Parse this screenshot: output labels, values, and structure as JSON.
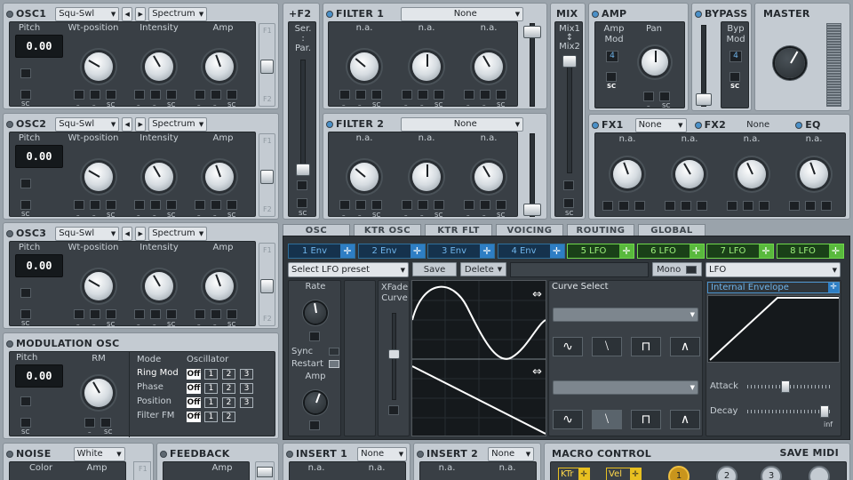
{
  "osc_rows": [
    {
      "title": "OSC1",
      "wave": "Squ-Swl",
      "mode": "Spectrum",
      "labels": [
        "Pitch",
        "Wt-position",
        "Intensity",
        "Amp"
      ],
      "pitch": "0.00"
    },
    {
      "title": "OSC2",
      "wave": "Squ-Swl",
      "mode": "Spectrum",
      "labels": [
        "Pitch",
        "Wt-position",
        "Intensity",
        "Amp"
      ],
      "pitch": "0.00"
    },
    {
      "title": "OSC3",
      "wave": "Squ-Swl",
      "mode": "Spectrum",
      "labels": [
        "Pitch",
        "Wt-position",
        "Intensity",
        "Amp"
      ],
      "pitch": "0.00"
    }
  ],
  "osc_f1": "F1",
  "osc_f2": "F2",
  "sc": "SC",
  "dash": "–",
  "arrow_left": "◀",
  "arrow_right": "▶",
  "f2_label": "+F2",
  "ser": "Ser.",
  "colon": ":",
  "par": "Par.",
  "filters": [
    {
      "title": "FILTER 1",
      "type": "None",
      "knobs": [
        "n.a.",
        "n.a.",
        "n.a."
      ]
    },
    {
      "title": "FILTER 2",
      "type": "None",
      "knobs": [
        "n.a.",
        "n.a.",
        "n.a."
      ]
    }
  ],
  "mix": {
    "title": "MIX",
    "top": "Mix1",
    "bot": "Mix2",
    "arrow": "↕"
  },
  "amp": {
    "title": "AMP",
    "mod": "Amp Mod",
    "mod_val": "4",
    "pan": "Pan"
  },
  "bypass": {
    "title": "BYPASS",
    "mod": "Byp Mod",
    "val": "4"
  },
  "master": {
    "title": "MASTER"
  },
  "fx": {
    "fx1": "FX1",
    "fx1_type": "None",
    "fx2": "FX2",
    "fx2_type": "None",
    "eq": "EQ",
    "knobs": [
      "n.a.",
      "n.a.",
      "n.a.",
      "n.a."
    ]
  },
  "tabs": [
    "OSC",
    "KTR OSC",
    "KTR FLT",
    "VOICING",
    "ROUTING",
    "GLOBAL"
  ],
  "mod_slots": [
    "1 Env",
    "2 Env",
    "3 Env",
    "4 Env",
    "5 LFO",
    "6 LFO",
    "7 LFO",
    "8 LFO"
  ],
  "move_icon": "✛",
  "lfo": {
    "preset": "Select LFO preset",
    "save": "Save",
    "delete": "Delete",
    "mono": "Mono",
    "type": "LFO",
    "rate": "Rate",
    "sync": "Sync",
    "restart": "Restart",
    "amp": "Amp",
    "xfade": "XFade Curve",
    "curve_select": "Curve Select",
    "internal_env": "Internal Envelope",
    "attack": "Attack",
    "decay": "Decay",
    "inf": "inf",
    "shapes": [
      "∿",
      "⧵",
      "⊓",
      "∧"
    ],
    "swap": "⇔"
  },
  "mod_osc": {
    "title": "MODULATION OSC",
    "pitch": "Pitch",
    "pitch_val": "0.00",
    "rm": "RM",
    "col_mode": "Mode",
    "col_osc": "Oscillator",
    "rows": [
      {
        "mode": "Ring Mod",
        "opts": [
          "1",
          "2",
          "3"
        ]
      },
      {
        "mode": "Phase",
        "opts": [
          "1",
          "2",
          "3"
        ]
      },
      {
        "mode": "Position",
        "opts": [
          "1",
          "2",
          "3"
        ]
      },
      {
        "mode": "Filter FM",
        "opts": [
          "1",
          "2"
        ]
      }
    ],
    "off": "Off"
  },
  "noise": {
    "title": "NOISE",
    "type": "White",
    "color": "Color",
    "amp": "Amp"
  },
  "feedback": {
    "title": "FEEDBACK",
    "amp": "Amp"
  },
  "insert1": {
    "title": "INSERT 1",
    "type": "None",
    "k1": "n.a.",
    "k2": "n.a."
  },
  "insert2": {
    "title": "INSERT 2",
    "type": "None",
    "k1": "n.a.",
    "k2": "n.a."
  },
  "macro": {
    "title": "MACRO CONTROL",
    "save": "SAVE MIDI",
    "ktr": "KTr",
    "vel": "Vel",
    "n1": "1",
    "n2": "2",
    "n3": "3"
  },
  "colors": {
    "panel": "#c4cbd2",
    "dark": "#393f45",
    "lfo_green": "#6fd84b",
    "env_blue": "#6fb4ea"
  }
}
